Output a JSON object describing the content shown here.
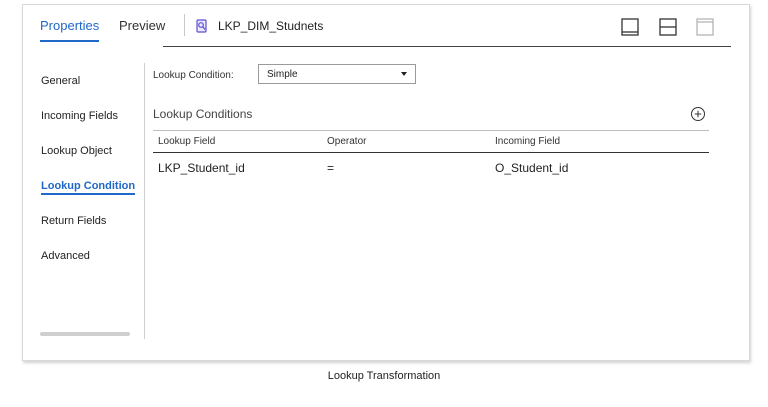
{
  "tabs": [
    {
      "label": "Properties",
      "active": true
    },
    {
      "label": "Preview",
      "active": false
    }
  ],
  "object": {
    "title": "LKP_DIM_Studnets",
    "icon": "lookup-object-icon"
  },
  "layout_buttons": [
    "layout-bottom-panel-icon",
    "layout-split-icon",
    "layout-top-panel-icon"
  ],
  "sidebar": {
    "items": [
      {
        "label": "General",
        "active": false
      },
      {
        "label": "Incoming Fields",
        "active": false
      },
      {
        "label": "Lookup Object",
        "active": false
      },
      {
        "label": "Lookup Condition",
        "active": true
      },
      {
        "label": "Return Fields",
        "active": false
      },
      {
        "label": "Advanced",
        "active": false
      }
    ]
  },
  "condition": {
    "label": "Lookup Condition:",
    "selected": "Simple"
  },
  "conditions": {
    "title": "Lookup Conditions",
    "add_icon": "add-circle-icon",
    "columns": [
      "Lookup Field",
      "Operator",
      "Incoming Field"
    ],
    "rows": [
      [
        "LKP_Student_id",
        "=",
        "O_Student_id"
      ]
    ]
  },
  "caption": "Lookup Transformation",
  "colors": {
    "accent": "#1f68c7",
    "icon_purple": "#5a4fcf"
  }
}
